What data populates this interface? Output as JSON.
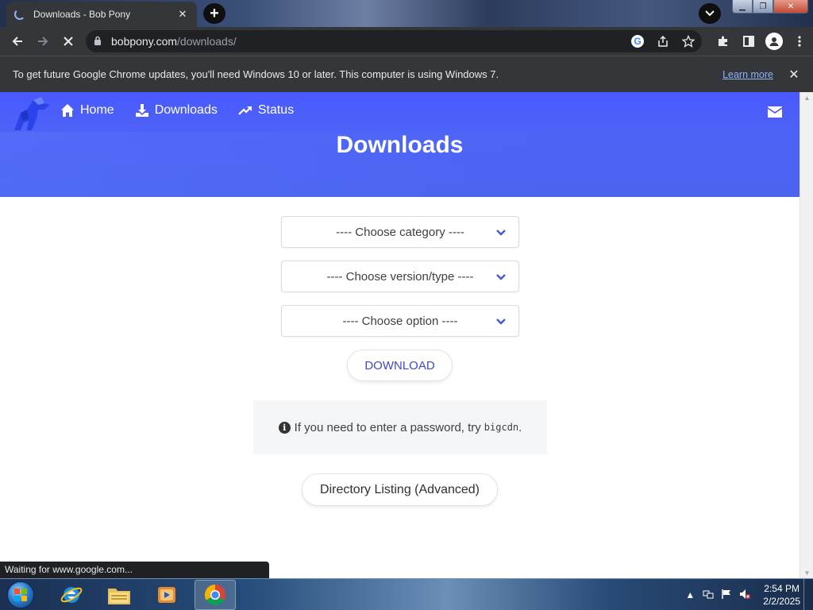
{
  "browser": {
    "tab_title": "Downloads - Bob Pony",
    "tab_close": "✕",
    "new_tab": "+",
    "url_host": "bobpony.com",
    "url_path": "/downloads/",
    "infobar_message": "To get future Google Chrome updates, you'll need Windows 10 or later. This computer is using Windows 7.",
    "infobar_link": "Learn more",
    "status_text": "Waiting for www.google.com..."
  },
  "site": {
    "nav": [
      {
        "label": "Home",
        "icon": "home-icon"
      },
      {
        "label": "Downloads",
        "icon": "download-icon"
      },
      {
        "label": "Status",
        "icon": "trending-up-icon"
      }
    ],
    "title": "Downloads",
    "selects": {
      "category": "---- Choose category ----",
      "version": "---- Choose version/type ----",
      "option": "---- Choose option ----"
    },
    "download_button": "DOWNLOAD",
    "notice_text": "If you need to enter a password, try",
    "notice_code": "bigcdn",
    "notice_end": ".",
    "directory_button": "Directory Listing (Advanced)",
    "colors": {
      "hero": "#4a59ff",
      "accent": "#3b49c8"
    }
  },
  "taskbar": {
    "time": "2:54 PM",
    "date": "2/2/2025"
  }
}
